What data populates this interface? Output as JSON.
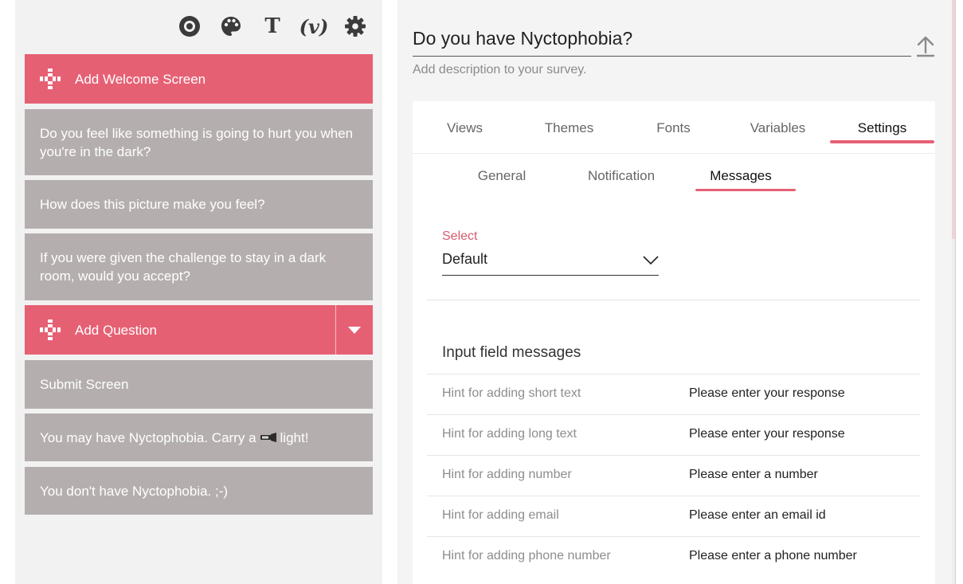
{
  "toolbar": {
    "icons": [
      "disc-icon",
      "palette-icon",
      "text-icon",
      "variables-icon",
      "gear-icon"
    ],
    "text_glyph": "T",
    "var_glyph": "(v)"
  },
  "builder": {
    "add_welcome_label": "Add Welcome Screen",
    "questions": [
      "Do you feel like something is going to hurt you when you're in the dark?",
      "How does this picture make you feel?",
      "If you were given the challenge to stay in a dark room, would you accept?"
    ],
    "add_question_label": "Add Question",
    "submit_label": "Submit Screen",
    "endings": {
      "ending1_before": "You may have Nyctophobia. Carry a",
      "ending1_after": "light!",
      "ending2": "You don't have Nyctophobia. ;-)"
    }
  },
  "survey": {
    "title": "Do you have Nyctophobia?",
    "description_placeholder": "Add description to your survey."
  },
  "tabs": [
    "Views",
    "Themes",
    "Fonts",
    "Variables",
    "Settings"
  ],
  "active_tab": "Settings",
  "subtabs": [
    "General",
    "Notification",
    "Messages"
  ],
  "active_subtab": "Messages",
  "select": {
    "label": "Select",
    "value": "Default"
  },
  "messages": {
    "title": "Input field messages",
    "rows": [
      {
        "key": "Hint for adding short text",
        "value": "Please enter your response"
      },
      {
        "key": "Hint for adding long text",
        "value": "Please enter your response"
      },
      {
        "key": "Hint for adding number",
        "value": "Please enter a number"
      },
      {
        "key": "Hint for adding email",
        "value": "Please enter an email id"
      },
      {
        "key": "Hint for adding phone number",
        "value": "Please enter a phone number"
      }
    ]
  },
  "colors": {
    "accent": "#e66074",
    "card_grey": "#b4afae",
    "panel_bg": "#f2f2f2"
  }
}
